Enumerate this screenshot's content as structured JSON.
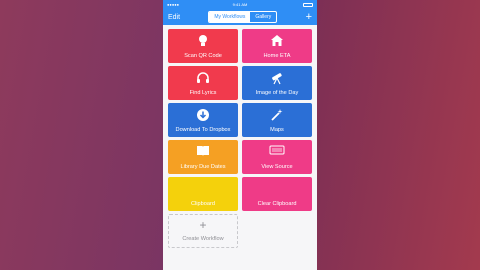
{
  "status": {
    "time": "9:41 AM"
  },
  "nav": {
    "edit": "Edit",
    "segments": [
      "My Workflows",
      "Gallery"
    ],
    "add": "+"
  },
  "tiles": [
    {
      "label": "Scan QR Code",
      "color": "#f13a4d",
      "icon": "lightbulb-icon"
    },
    {
      "label": "Home ETA",
      "color": "#ef3b87",
      "icon": "house-icon"
    },
    {
      "label": "Find Lyrics",
      "color": "#f13a4d",
      "icon": "headphones-icon"
    },
    {
      "label": "Image of the Day",
      "color": "#2b6fd6",
      "icon": "telescope-icon"
    },
    {
      "label": "Download To Dropbox",
      "color": "#2b6fd6",
      "icon": "download-arrow-icon"
    },
    {
      "label": "Maps",
      "color": "#2b6fd6",
      "icon": "magic-wand-icon"
    },
    {
      "label": "Library Due Dates",
      "color": "#f5a023",
      "icon": "book-icon"
    },
    {
      "label": "View Source",
      "color": "#ef3b87",
      "icon": "keyboard-icon"
    },
    {
      "label": "Clipboard",
      "color": "#f4d10c",
      "icon": ""
    },
    {
      "label": "Clear Clipboard",
      "color": "#ef3b87",
      "icon": ""
    }
  ],
  "create": {
    "plus": "+",
    "label": "Create Workflow"
  }
}
